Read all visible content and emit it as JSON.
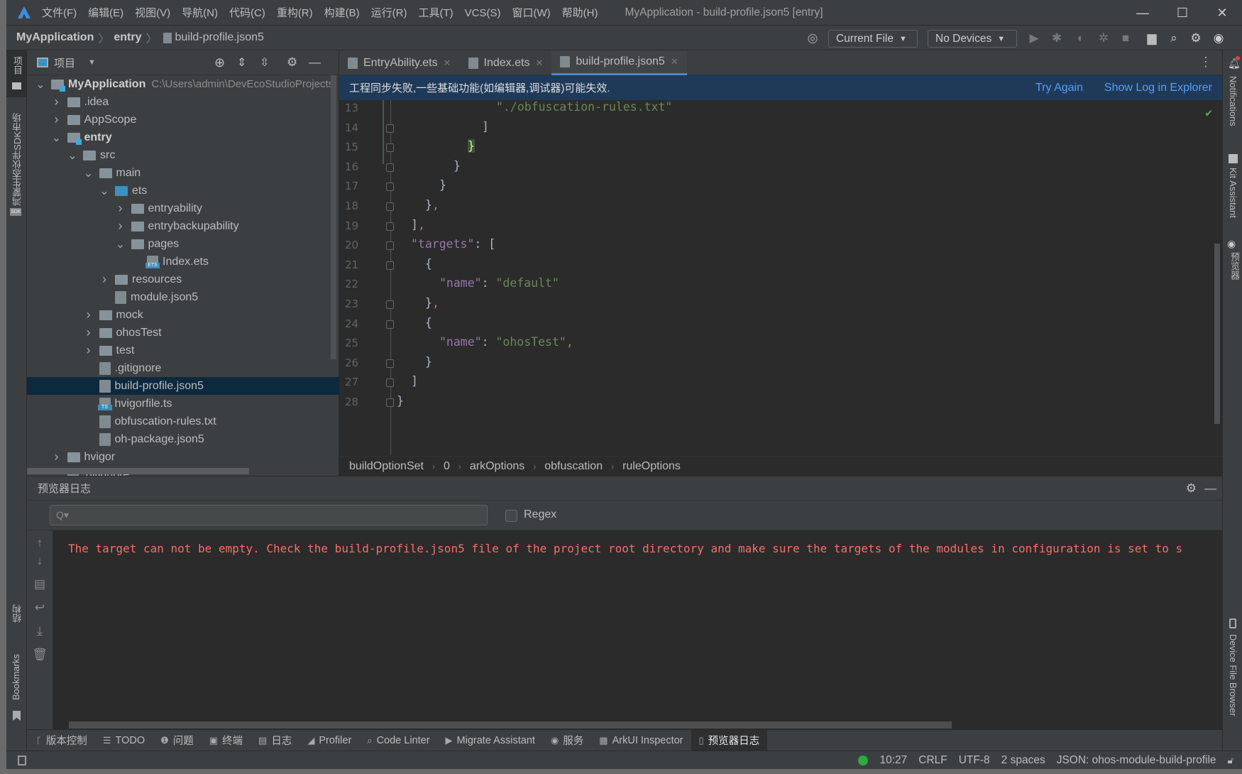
{
  "app": {
    "window_title": "MyApplication - build-profile.json5 [entry]"
  },
  "menu": [
    "文件(F)",
    "编辑(E)",
    "视图(V)",
    "导航(N)",
    "代码(C)",
    "重构(R)",
    "构建(B)",
    "运行(R)",
    "工具(T)",
    "VCS(S)",
    "窗口(W)",
    "帮助(H)"
  ],
  "nav": {
    "crumbs": [
      "MyApplication",
      "entry",
      "build-profile.json5"
    ],
    "run_config": "Current File",
    "device": "No Devices"
  },
  "left_strip": {
    "project": "项目",
    "sdk_market": "鸿蒙生态伙伴SDK市场",
    "sdk_badge": "SDK",
    "structure": "结构",
    "bookmarks": "Bookmarks"
  },
  "right_strip": {
    "notifications": "Notifications",
    "kit_assistant": "Kit Assistant",
    "previewer": "预览器",
    "device_file_browser": "Device File Browser"
  },
  "project": {
    "title": "项目",
    "tree": [
      {
        "level": 0,
        "name": "MyApplication",
        "type": "module",
        "expanded": true,
        "bold": true,
        "hint": "C:\\Users\\admin\\DevEcoStudioProjects"
      },
      {
        "level": 1,
        "name": ".idea",
        "type": "folder",
        "expanded": false
      },
      {
        "level": 1,
        "name": "AppScope",
        "type": "folder",
        "expanded": false
      },
      {
        "level": 1,
        "name": "entry",
        "type": "module",
        "expanded": true,
        "bold": true
      },
      {
        "level": 2,
        "name": "src",
        "type": "folder",
        "expanded": true
      },
      {
        "level": 3,
        "name": "main",
        "type": "folder",
        "expanded": true
      },
      {
        "level": 4,
        "name": "ets",
        "type": "folder-blue",
        "expanded": true
      },
      {
        "level": 5,
        "name": "entryability",
        "type": "folder",
        "expanded": false
      },
      {
        "level": 5,
        "name": "entrybackupability",
        "type": "folder",
        "expanded": false
      },
      {
        "level": 5,
        "name": "pages",
        "type": "folder",
        "expanded": true
      },
      {
        "level": 6,
        "name": "Index.ets",
        "type": "ets"
      },
      {
        "level": 4,
        "name": "resources",
        "type": "folder",
        "expanded": false
      },
      {
        "level": 4,
        "name": "module.json5",
        "type": "json"
      },
      {
        "level": 3,
        "name": "mock",
        "type": "folder",
        "expanded": false
      },
      {
        "level": 3,
        "name": "ohosTest",
        "type": "folder",
        "expanded": false
      },
      {
        "level": 3,
        "name": "test",
        "type": "folder",
        "expanded": false
      },
      {
        "level": 3,
        "name": ".gitignore",
        "type": "ignore"
      },
      {
        "level": 3,
        "name": "build-profile.json5",
        "type": "json",
        "selected": true
      },
      {
        "level": 3,
        "name": "hvigorfile.ts",
        "type": "ts"
      },
      {
        "level": 3,
        "name": "obfuscation-rules.txt",
        "type": "txt"
      },
      {
        "level": 3,
        "name": "oh-package.json5",
        "type": "json"
      },
      {
        "level": 1,
        "name": "hvigor",
        "type": "folder",
        "expanded": false
      },
      {
        "level": 1,
        "name": ".gitignore",
        "type": "ignore"
      }
    ]
  },
  "editor": {
    "tabs": [
      {
        "label": "EntryAbility.ets",
        "active": false
      },
      {
        "label": "Index.ets",
        "active": false
      },
      {
        "label": "build-profile.json5",
        "active": true
      }
    ],
    "banner": {
      "message": "工程同步失败,一些基础功能(如编辑器,调试器)可能失效.",
      "try_again": "Try Again",
      "show_log": "Show Log in Explorer"
    },
    "lines": [
      {
        "n": "13",
        "indent": 14,
        "parts": [
          [
            "s",
            "\"./obfuscation-rules.txt\""
          ]
        ]
      },
      {
        "n": "14",
        "indent": 12,
        "parts": [
          [
            "p",
            "]"
          ]
        ]
      },
      {
        "n": "15",
        "indent": 10,
        "parts": [
          [
            "hl",
            "}"
          ]
        ]
      },
      {
        "n": "16",
        "indent": 8,
        "parts": [
          [
            "p",
            "}"
          ]
        ]
      },
      {
        "n": "17",
        "indent": 6,
        "parts": [
          [
            "p",
            "}"
          ]
        ]
      },
      {
        "n": "18",
        "indent": 4,
        "parts": [
          [
            "p",
            "}"
          ],
          [
            "c",
            ","
          ]
        ]
      },
      {
        "n": "19",
        "indent": 2,
        "parts": [
          [
            "p",
            "]"
          ],
          [
            "c",
            ","
          ]
        ]
      },
      {
        "n": "20",
        "indent": 2,
        "parts": [
          [
            "k",
            "\"targets\""
          ],
          [
            "p",
            ": ["
          ]
        ]
      },
      {
        "n": "21",
        "indent": 4,
        "parts": [
          [
            "p",
            "{"
          ]
        ]
      },
      {
        "n": "22",
        "indent": 6,
        "parts": [
          [
            "k",
            "\"name\""
          ],
          [
            "p",
            ": "
          ],
          [
            "s",
            "\"default\""
          ]
        ]
      },
      {
        "n": "23",
        "indent": 4,
        "parts": [
          [
            "p",
            "}"
          ],
          [
            "c",
            ","
          ]
        ]
      },
      {
        "n": "24",
        "indent": 4,
        "parts": [
          [
            "p",
            "{"
          ]
        ]
      },
      {
        "n": "25",
        "indent": 6,
        "parts": [
          [
            "k",
            "\"name\""
          ],
          [
            "p",
            ": "
          ],
          [
            "s",
            "\"ohosTest\""
          ],
          [
            "c",
            ","
          ]
        ]
      },
      {
        "n": "26",
        "indent": 4,
        "parts": [
          [
            "p",
            "}"
          ]
        ]
      },
      {
        "n": "27",
        "indent": 2,
        "parts": [
          [
            "p",
            "]"
          ]
        ]
      },
      {
        "n": "28",
        "indent": 0,
        "parts": [
          [
            "p",
            "}"
          ]
        ]
      }
    ],
    "breadcrumb": [
      "buildOptionSet",
      "0",
      "arkOptions",
      "obfuscation",
      "ruleOptions"
    ]
  },
  "log_panel": {
    "title": "预览器日志",
    "search_placeholder": "Q▾",
    "regex_label": "Regex",
    "regex_checked": false,
    "message": "The target can not be empty. Check the build-profile.json5 file of the project root directory and make sure the targets of the modules in configuration is set to s"
  },
  "tool_windows": [
    {
      "icon": "branch-icon",
      "glyph": "ᚴ",
      "label": "版本控制"
    },
    {
      "icon": "list-icon",
      "glyph": "☰",
      "label": "TODO"
    },
    {
      "icon": "problems-icon",
      "glyph": "❶",
      "label": "问题"
    },
    {
      "icon": "terminal-icon",
      "glyph": "▣",
      "label": "终端"
    },
    {
      "icon": "log-icon",
      "glyph": "▤",
      "label": "日志"
    },
    {
      "icon": "profiler-icon",
      "glyph": "◢",
      "label": "Profiler"
    },
    {
      "icon": "code-linter-icon",
      "glyph": "⌕",
      "label": "Code Linter"
    },
    {
      "icon": "migrate-icon",
      "glyph": "▶",
      "label": "Migrate Assistant"
    },
    {
      "icon": "services-icon",
      "glyph": "◉",
      "label": "服务"
    },
    {
      "icon": "inspector-icon",
      "glyph": "▦",
      "label": "ArkUI Inspector"
    },
    {
      "icon": "previewer-log-icon",
      "glyph": "▯",
      "label": "预览器日志",
      "active": true
    }
  ],
  "status": {
    "position": "10:27",
    "line_sep": "CRLF",
    "encoding": "UTF-8",
    "indent": "2 spaces",
    "schema": "JSON: ohos-module-build-profile"
  },
  "colors": {
    "accent": "#4a88c7",
    "banner": "#1f3a59",
    "error": "#ff6b68",
    "selected_row": "#0d293e",
    "status_ok": "#2eaa3f"
  }
}
